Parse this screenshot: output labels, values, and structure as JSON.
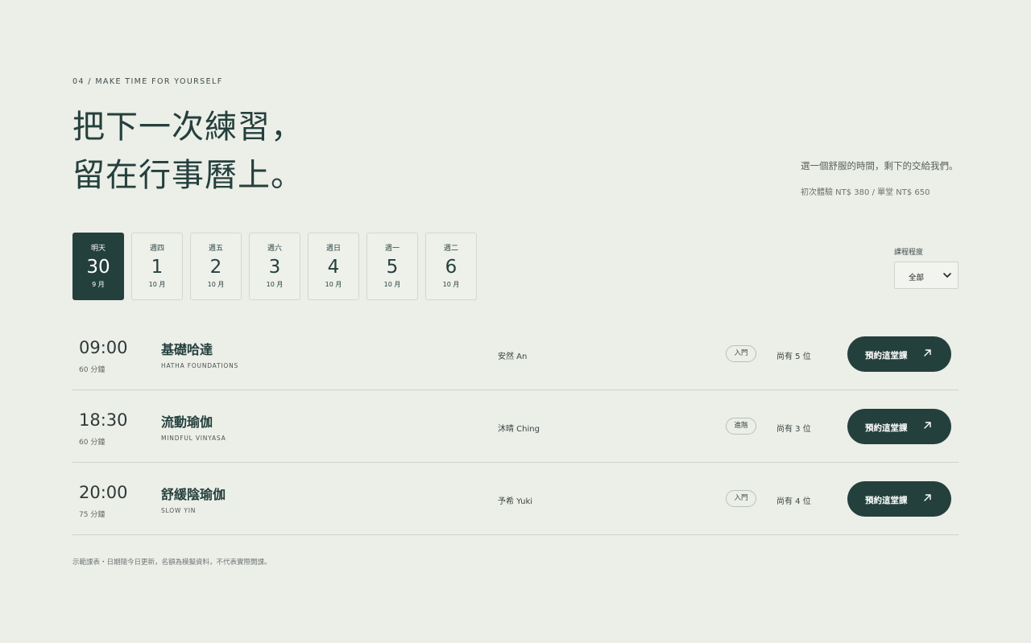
{
  "section": {
    "eyebrow": "04 / MAKE TIME FOR YOURSELF",
    "headline_line1": "把下一次練習，",
    "headline_line2": "留在行事曆上。",
    "tagline": "選一個舒服的時間，剩下的交給我們。",
    "pricing": "初次體驗 NT$ 380 / 單堂 NT$ 650"
  },
  "days": [
    {
      "weekday": "明天",
      "day": "30",
      "month": "9 月",
      "selected": true
    },
    {
      "weekday": "週四",
      "day": "1",
      "month": "10 月",
      "selected": false
    },
    {
      "weekday": "週五",
      "day": "2",
      "month": "10 月",
      "selected": false
    },
    {
      "weekday": "週六",
      "day": "3",
      "month": "10 月",
      "selected": false
    },
    {
      "weekday": "週日",
      "day": "4",
      "month": "10 月",
      "selected": false
    },
    {
      "weekday": "週一",
      "day": "5",
      "month": "10 月",
      "selected": false
    },
    {
      "weekday": "週二",
      "day": "6",
      "month": "10 月",
      "selected": false
    }
  ],
  "filter": {
    "label": "課程程度",
    "selected": "全部"
  },
  "classes": [
    {
      "time": "09:00",
      "duration": "60 分鐘",
      "name": "基礎哈達",
      "subtitle": "HATHA FOUNDATIONS",
      "instructor": "安然 An",
      "level": "入門",
      "spots": "尚有 5 位",
      "cta": "預約這堂課"
    },
    {
      "time": "18:30",
      "duration": "60 分鐘",
      "name": "流動瑜伽",
      "subtitle": "MINDFUL VINYASA",
      "instructor": "沐晴 Ching",
      "level": "進階",
      "spots": "尚有 3 位",
      "cta": "預約這堂課"
    },
    {
      "time": "20:00",
      "duration": "75 分鐘",
      "name": "舒緩陰瑜伽",
      "subtitle": "SLOW YIN",
      "instructor": "予希 Yuki",
      "level": "入門",
      "spots": "尚有 4 位",
      "cta": "預約這堂課"
    }
  ],
  "footnote": "示範課表・日期隨今日更新，名額為模擬資料，不代表實際開課。",
  "colors": {
    "background": "#eceee8",
    "accent": "#24403d",
    "text": "#26403e"
  },
  "icons": {
    "book_arrow": "arrow-up-right-icon",
    "select": "chevron-down-icon"
  }
}
